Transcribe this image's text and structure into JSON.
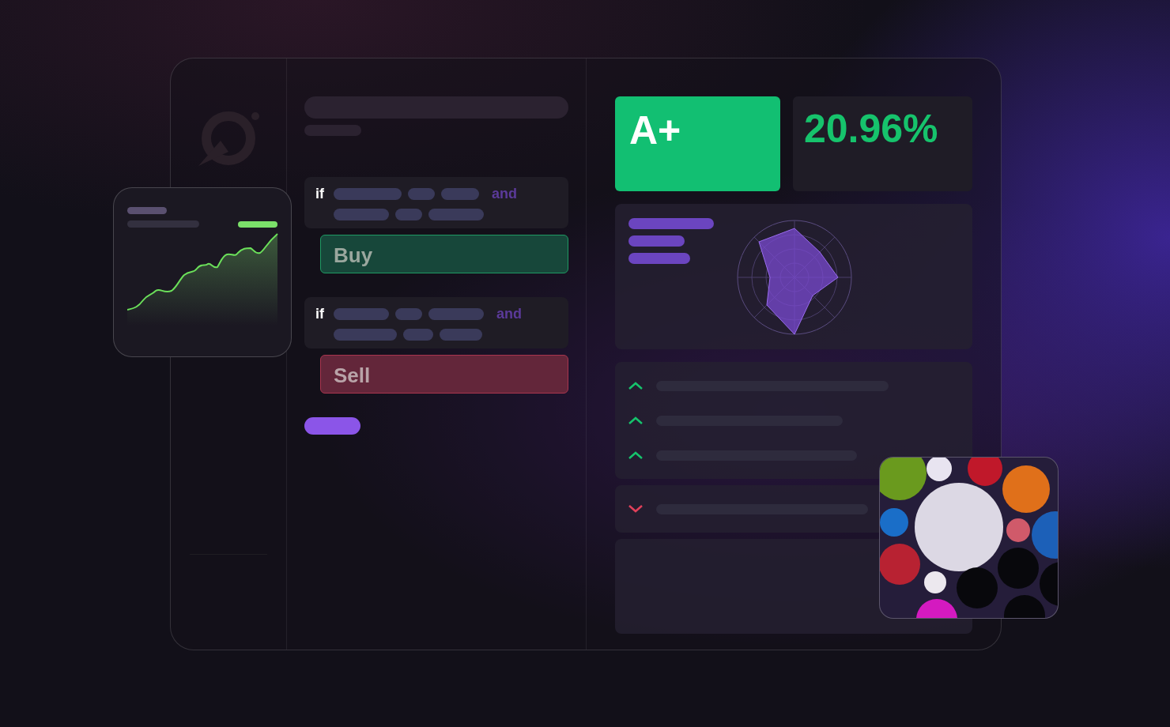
{
  "rules": [
    {
      "keyword": "if",
      "conjunction": "and",
      "action": "Buy",
      "kind": "buy"
    },
    {
      "keyword": "if",
      "conjunction": "and",
      "action": "Sell",
      "kind": "sell"
    }
  ],
  "grade": "A+",
  "return": "20.96%",
  "signals": [
    {
      "kind": "up"
    },
    {
      "kind": "up"
    },
    {
      "kind": "up"
    }
  ],
  "alerts": [
    {
      "kind": "down"
    }
  ]
}
